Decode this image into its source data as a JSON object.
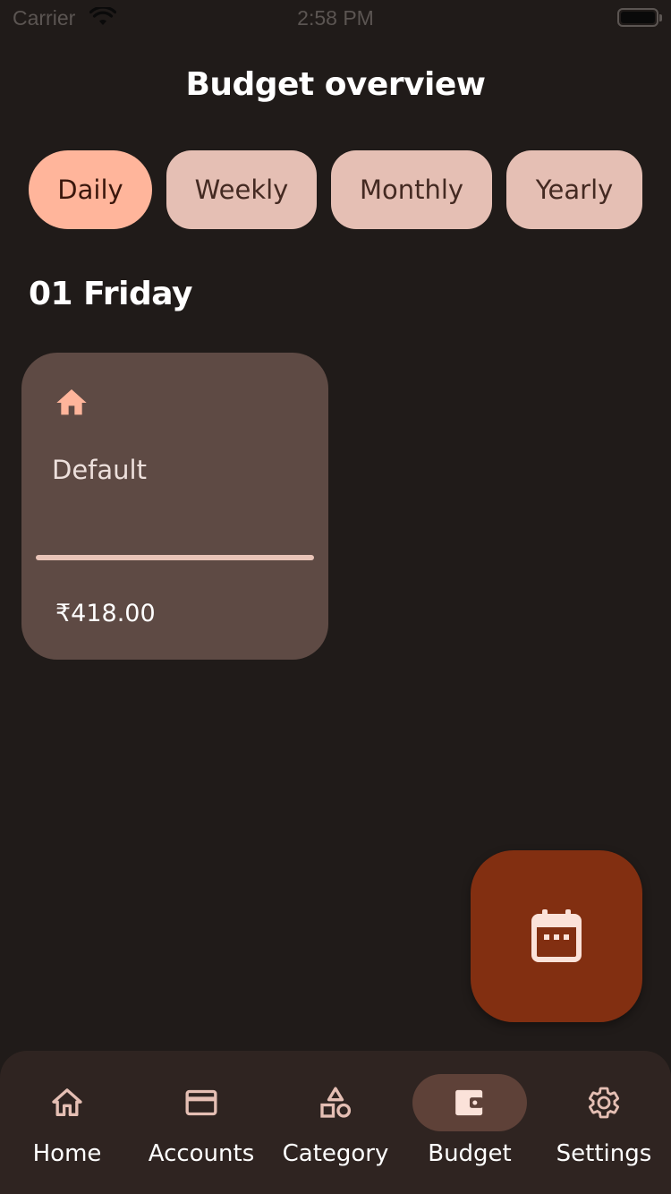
{
  "status_bar": {
    "carrier": "Carrier",
    "time": "2:58 PM"
  },
  "title": "Budget overview",
  "period_tabs": [
    {
      "label": "Daily",
      "active": true
    },
    {
      "label": "Weekly",
      "active": false
    },
    {
      "label": "Monthly",
      "active": false
    },
    {
      "label": "Yearly",
      "active": false
    }
  ],
  "date_heading": "01 Friday",
  "budget_cards": [
    {
      "icon": "home-icon",
      "name": "Default",
      "amount": "₹418.00",
      "progress": 1.0
    }
  ],
  "fab": {
    "icon": "calendar-icon"
  },
  "bottom_nav": [
    {
      "label": "Home",
      "icon": "home-icon",
      "active": false
    },
    {
      "label": "Accounts",
      "icon": "credit-card-icon",
      "active": false
    },
    {
      "label": "Category",
      "icon": "shapes-icon",
      "active": false
    },
    {
      "label": "Budget",
      "icon": "wallet-icon",
      "active": true
    },
    {
      "label": "Settings",
      "icon": "gear-icon",
      "active": false
    }
  ],
  "colors": {
    "background": "#201b19",
    "chip": "#e5bfb4",
    "chip_active": "#ffb59b",
    "card": "#5e4a44",
    "accent_icon": "#ffb59b",
    "fab": "#822f11",
    "nav_bar": "#2f2421",
    "nav_active_pill": "#5e4138"
  }
}
